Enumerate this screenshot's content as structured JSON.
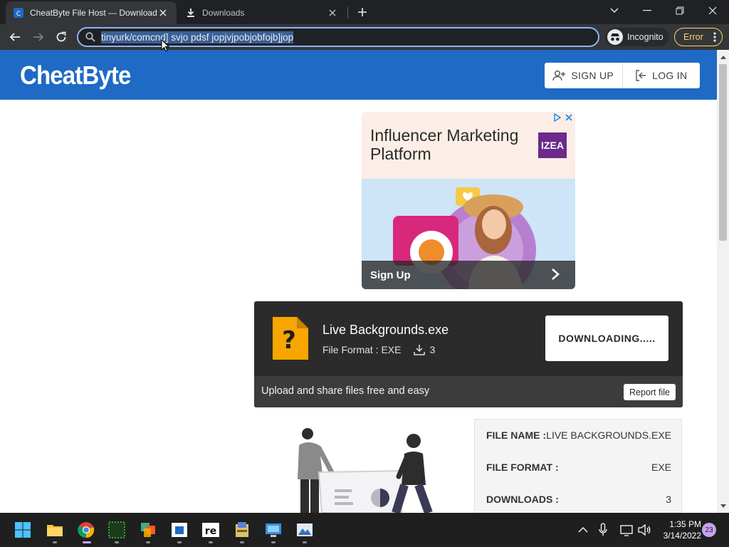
{
  "browser": {
    "tabs": [
      {
        "title": "CheatByte File Host — Download",
        "active": true
      },
      {
        "title": "Downloads",
        "active": false
      }
    ],
    "address_bar": {
      "url": "tinyurk/comcnd] svjo pdsf jopjvjpobjobfojb]jop"
    },
    "profile": {
      "label": "Incognito"
    },
    "error_chip": {
      "label": "Error"
    }
  },
  "site": {
    "logo": "CheatByte",
    "auth": {
      "signup": "SIGN UP",
      "login": "LOG IN"
    }
  },
  "ad": {
    "headline": "Influencer Marketing Platform",
    "brand": "IZEA",
    "cta": "Sign Up"
  },
  "download": {
    "file_name": "Live Backgrounds.exe",
    "format_label": "File Format : EXE",
    "download_count": "3",
    "button_label": "DOWNLOADING.....",
    "tagline": "Upload and share files free and easy",
    "report_label": "Report file"
  },
  "details": [
    {
      "key": "FILE NAME :",
      "value": "LIVE BACKGROUNDS.EXE"
    },
    {
      "key": "FILE FORMAT :",
      "value": "EXE"
    },
    {
      "key": "DOWNLOADS :",
      "value": "3"
    }
  ],
  "taskbar": {
    "time": "1:35 PM",
    "date": "3/14/2022",
    "notifications": "23"
  },
  "colors": {
    "header_blue": "#1e6ac5",
    "card_dark": "#2b2b2b",
    "error_yellow": "#fdd663",
    "omnibox_focus": "#8ab4f8"
  }
}
